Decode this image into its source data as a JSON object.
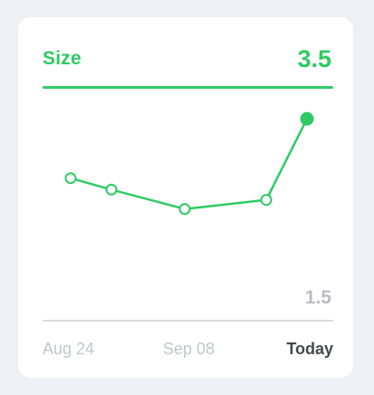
{
  "card": {
    "metric_label": "Size",
    "current_value": "3.5",
    "min_value": "1.5"
  },
  "x_labels": [
    "Aug 24",
    "Sep 08",
    "Today"
  ],
  "chart_data": {
    "type": "line",
    "x": [
      "Aug 24",
      "",
      "Sep 08",
      "",
      "Today"
    ],
    "values": [
      2.55,
      2.45,
      2.28,
      2.36,
      3.07
    ],
    "ylim": [
      1.5,
      3.5
    ],
    "title": "",
    "xlabel": "",
    "ylabel": "",
    "grid": false,
    "line_color": "#2ecb63",
    "last_point_filled": true
  },
  "colors": {
    "accent": "#2ecb63",
    "muted_text": "#c2c6cc",
    "strong_text": "#44484f"
  }
}
